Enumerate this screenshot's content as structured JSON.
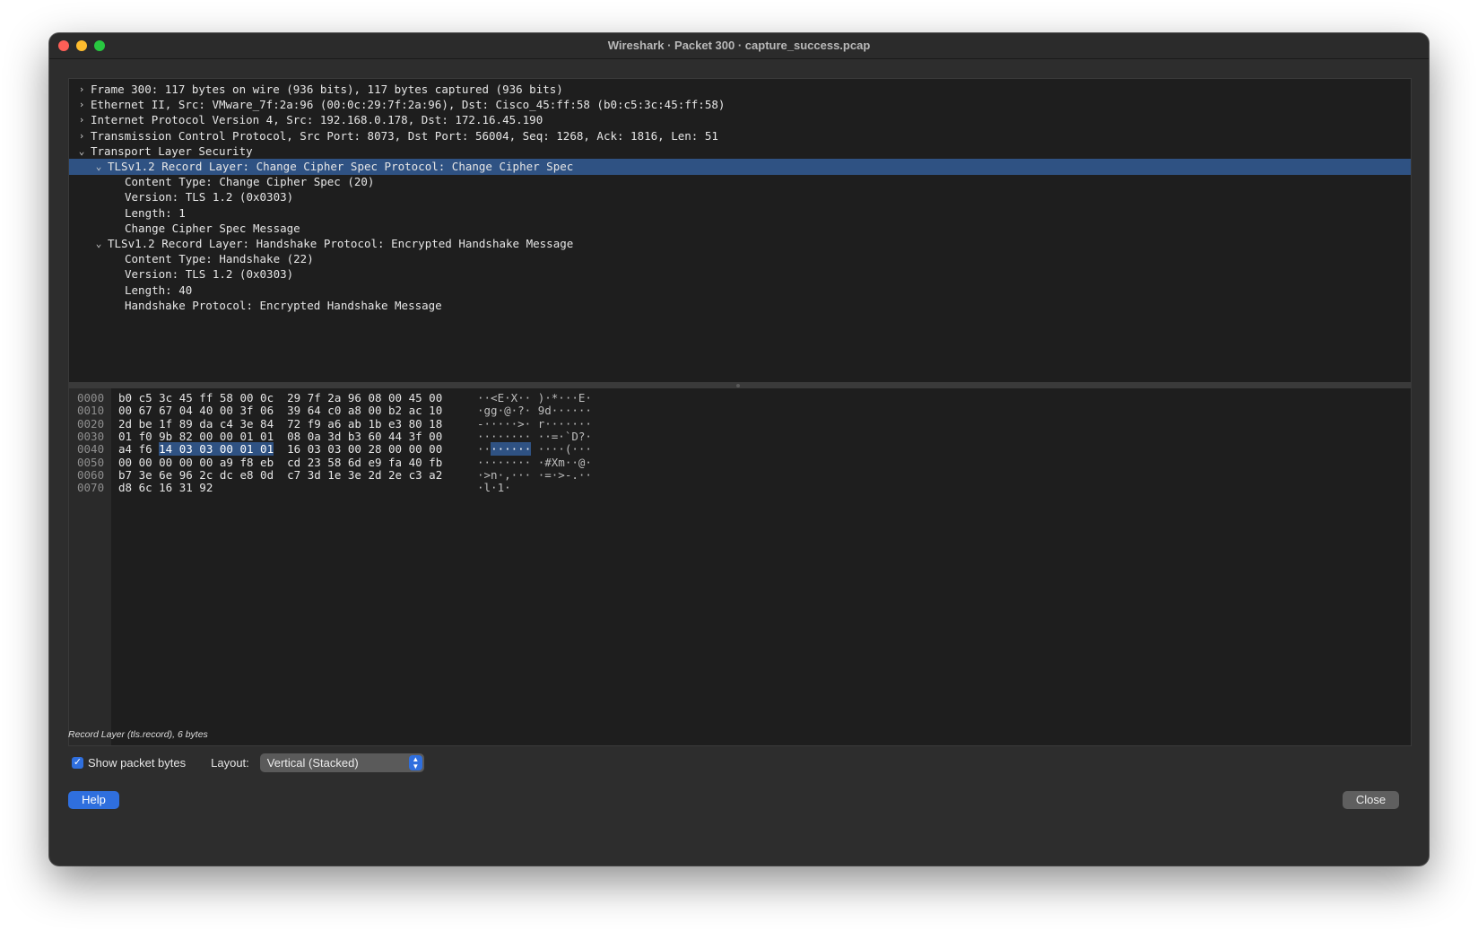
{
  "window": {
    "title": "Wireshark · Packet 300 · capture_success.pcap"
  },
  "tree": [
    {
      "text": "Frame 300: 117 bytes on wire (936 bits), 117 bytes captured (936 bits)",
      "chevron": "›",
      "expanded": false
    },
    {
      "text": "Ethernet II, Src: VMware_7f:2a:96 (00:0c:29:7f:2a:96), Dst: Cisco_45:ff:58 (b0:c5:3c:45:ff:58)",
      "chevron": "›",
      "expanded": false
    },
    {
      "text": "Internet Protocol Version 4, Src: 192.168.0.178, Dst: 172.16.45.190",
      "chevron": "›",
      "expanded": false
    },
    {
      "text": "Transmission Control Protocol, Src Port: 8073, Dst Port: 56004, Seq: 1268, Ack: 1816, Len: 51",
      "chevron": "›",
      "expanded": false
    },
    {
      "text": "Transport Layer Security",
      "chevron": "⌄",
      "expanded": true
    },
    {
      "text": "TLSv1.2 Record Layer: Change Cipher Spec Protocol: Change Cipher Spec",
      "chevron": "⌄",
      "expanded": true,
      "selected": true
    },
    {
      "text": "Content Type: Change Cipher Spec (20)",
      "chevron": ""
    },
    {
      "text": "Version: TLS 1.2 (0x0303)",
      "chevron": ""
    },
    {
      "text": "Length: 1",
      "chevron": ""
    },
    {
      "text": "Change Cipher Spec Message",
      "chevron": ""
    },
    {
      "text": "TLSv1.2 Record Layer: Handshake Protocol: Encrypted Handshake Message",
      "chevron": "⌄",
      "expanded": true
    },
    {
      "text": "Content Type: Handshake (22)",
      "chevron": ""
    },
    {
      "text": "Version: TLS 1.2 (0x0303)",
      "chevron": ""
    },
    {
      "text": "Length: 40",
      "chevron": ""
    },
    {
      "text": "Handshake Protocol: Encrypted Handshake Message",
      "chevron": ""
    }
  ],
  "hex": [
    {
      "offset": "0000",
      "bytes": "b0 c5 3c 45 ff 58 00 0c  29 7f 2a 96 08 00 45 00",
      "ascii": "··<E·X·· )·*···E·"
    },
    {
      "offset": "0010",
      "bytes": "00 67 67 04 40 00 3f 06  39 64 c0 a8 00 b2 ac 10",
      "ascii": "·gg·@·?· 9d······"
    },
    {
      "offset": "0020",
      "bytes": "2d be 1f 89 da c4 3e 84  72 f9 a6 ab 1b e3 80 18",
      "ascii": "-·····>· r·······"
    },
    {
      "offset": "0030",
      "bytes": "01 f0 9b 82 00 00 01 01  08 0a 3d b3 60 44 3f 00",
      "ascii": "········ ··=·`D?·"
    },
    {
      "offset": "0040",
      "bytes_pre": "a4 f6 ",
      "bytes_hl": "14 03 03 00 01 01",
      "bytes_post": "  16 03 03 00 28 00 00 00",
      "ascii_pre": "··",
      "ascii_hl": "······",
      "ascii_post": " ····(···"
    },
    {
      "offset": "0050",
      "bytes": "00 00 00 00 00 a9 f8 eb  cd 23 58 6d e9 fa 40 fb",
      "ascii": "········ ·#Xm··@·"
    },
    {
      "offset": "0060",
      "bytes": "b7 3e 6e 96 2c dc e8 0d  c7 3d 1e 3e 2d 2e c3 a2",
      "ascii": "·>n·,··· ·=·>-.··"
    },
    {
      "offset": "0070",
      "bytes": "d8 6c 16 31 92",
      "ascii": "·l·1·"
    }
  ],
  "status": "Record Layer (tls.record), 6 bytes",
  "options": {
    "show_bytes_label": "Show packet bytes",
    "show_bytes_checked": true,
    "layout_label": "Layout:",
    "layout_value": "Vertical (Stacked)"
  },
  "buttons": {
    "help": "Help",
    "close": "Close"
  },
  "colors": {
    "selection": "#2f5283",
    "accent": "#2f6fde"
  }
}
